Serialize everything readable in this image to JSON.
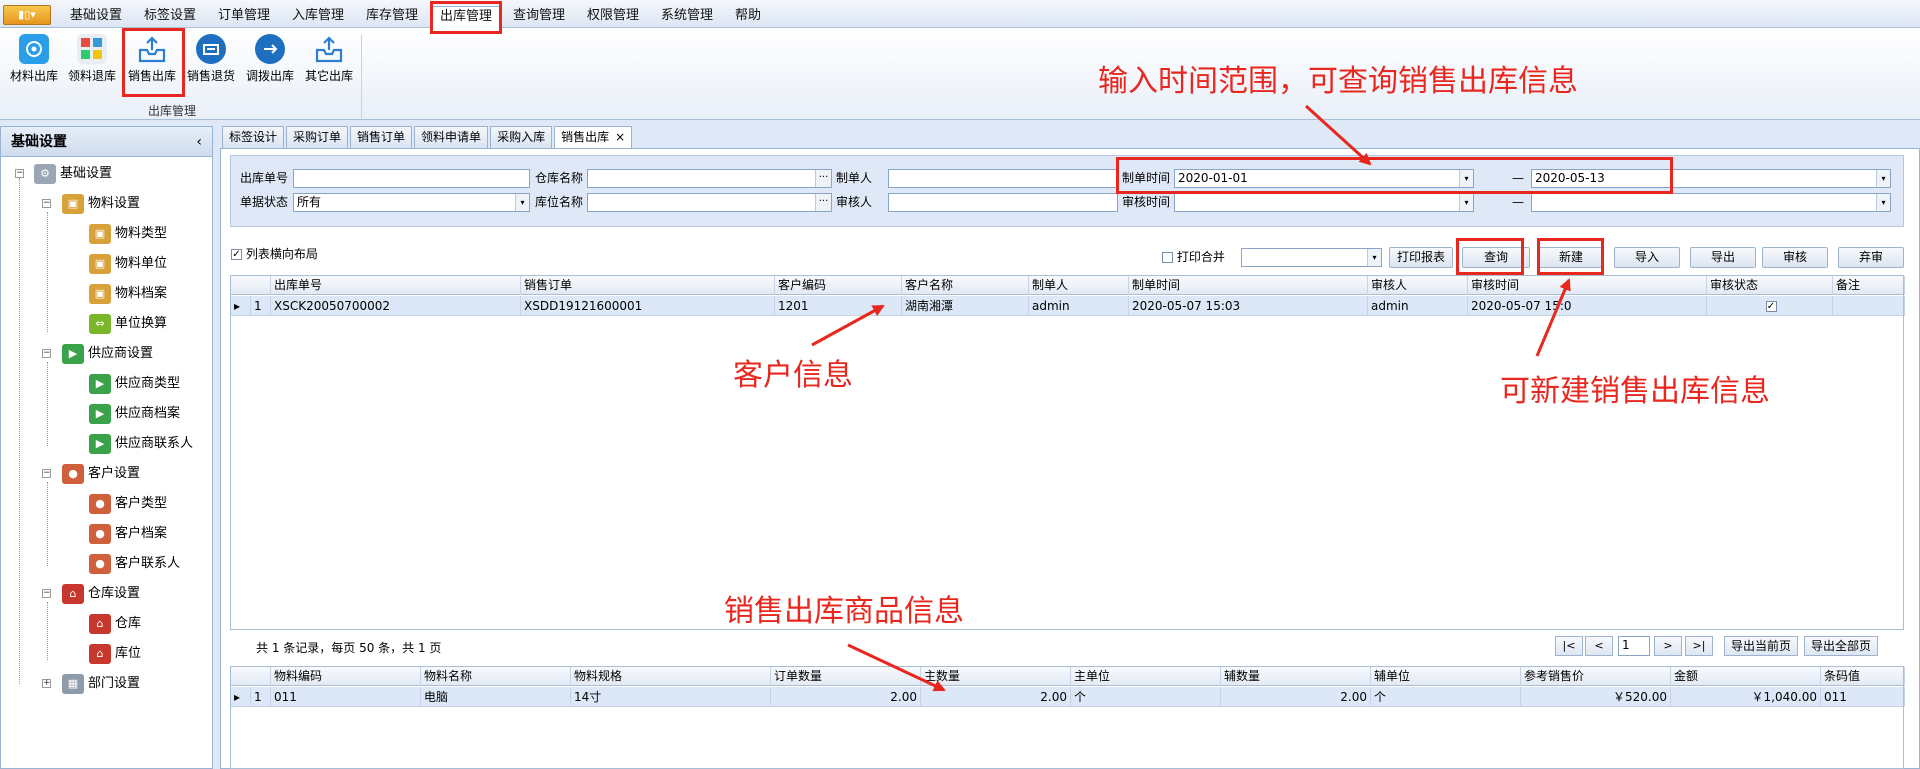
{
  "menubar": {
    "app_button": "▮▯▾",
    "items": [
      "基础设置",
      "标签设置",
      "订单管理",
      "入库管理",
      "库存管理",
      "出库管理",
      "查询管理",
      "权限管理",
      "系统管理",
      "帮助"
    ]
  },
  "ribbon": {
    "buttons": [
      "材料出库",
      "领料退库",
      "销售出库",
      "销售退货",
      "调拨出库",
      "其它出库"
    ],
    "group_label": "出库管理"
  },
  "left_panel": {
    "title": "基础设置",
    "collapse": "‹",
    "tree": {
      "root": "基础设置",
      "material": "物料设置",
      "material_type": "物料类型",
      "material_unit": "物料单位",
      "material_archive": "物料档案",
      "unit_convert": "单位换算",
      "supplier": "供应商设置",
      "supplier_type": "供应商类型",
      "supplier_archive": "供应商档案",
      "supplier_contact": "供应商联系人",
      "customer": "客户设置",
      "customer_type": "客户类型",
      "customer_archive": "客户档案",
      "customer_contact": "客户联系人",
      "warehouse_set": "仓库设置",
      "warehouse": "仓库",
      "location": "库位",
      "department": "部门设置"
    }
  },
  "tabs": [
    "标签设计",
    "采购订单",
    "销售订单",
    "领料申请单",
    "采购入库",
    "销售出库"
  ],
  "tab_close": "×",
  "filters": {
    "out_no_label": "出库单号",
    "warehouse_label": "仓库名称",
    "creator_label": "制单人",
    "create_time_label": "制单时间",
    "create_time_from": "2020-01-01",
    "create_time_to": "2020-05-13",
    "status_label": "单据状态",
    "status_value": "所有",
    "location_label": "库位名称",
    "auditor_label": "审核人",
    "audit_time_label": "审核时间",
    "dash": "—",
    "ellipsis": "···",
    "dropdown": "▾"
  },
  "toolbar": {
    "horizontal_layout_label": "列表横向布局",
    "print_merge_label": "打印合并",
    "print_report": "打印报表",
    "query": "查询",
    "new": "新建",
    "import": "导入",
    "export": "导出",
    "audit": "审核",
    "unaudit": "弃审",
    "check_mark": "✓"
  },
  "grid": {
    "columns": [
      "出库单号",
      "销售订单",
      "客户编码",
      "客户名称",
      "制单人",
      "制单时间",
      "审核人",
      "审核时间",
      "审核状态",
      "备注"
    ],
    "rows": [
      {
        "index": "1",
        "out_no": "XSCK20050700002",
        "sales_order": "XSDD19121600001",
        "customer_code": "1201",
        "customer_name": "湖南湘潭",
        "creator": "admin",
        "create_time": "2020-05-07 15:03",
        "auditor": "admin",
        "audit_time": "2020-05-07 15:0",
        "audit_status": "✓",
        "remark": ""
      }
    ],
    "row_marker": "▸"
  },
  "pager": {
    "summary": "共 1 条记录，每页 50 条，共 1 页",
    "first": "|<",
    "prev": "<",
    "page": "1",
    "next": ">",
    "last": ">|",
    "export_current": "导出当前页",
    "export_all": "导出全部页"
  },
  "detail_grid": {
    "columns": [
      "物料编码",
      "物料名称",
      "物料规格",
      "订单数量",
      "主数量",
      "主单位",
      "辅数量",
      "辅单位",
      "参考销售价",
      "金额",
      "条码值"
    ],
    "rows": [
      {
        "index": "1",
        "code": "011",
        "name": "电脑",
        "spec": "14寸",
        "order_qty": "2.00",
        "main_qty": "2.00",
        "main_unit": "个",
        "aux_qty": "2.00",
        "aux_unit": "个",
        "ref_price": "￥520.00",
        "amount": "￥1,040.00",
        "barcode": "011"
      }
    ]
  },
  "annotations": {
    "time_range": "输入时间范围，可查询销售出库信息",
    "customer_info": "客户信息",
    "new_info": "可新建销售出库信息",
    "goods_info": "销售出库商品信息"
  },
  "colors": {
    "annotation_red": "#e8271e",
    "selected_row": "#dce8f7",
    "panel_border": "#99b3d3"
  }
}
